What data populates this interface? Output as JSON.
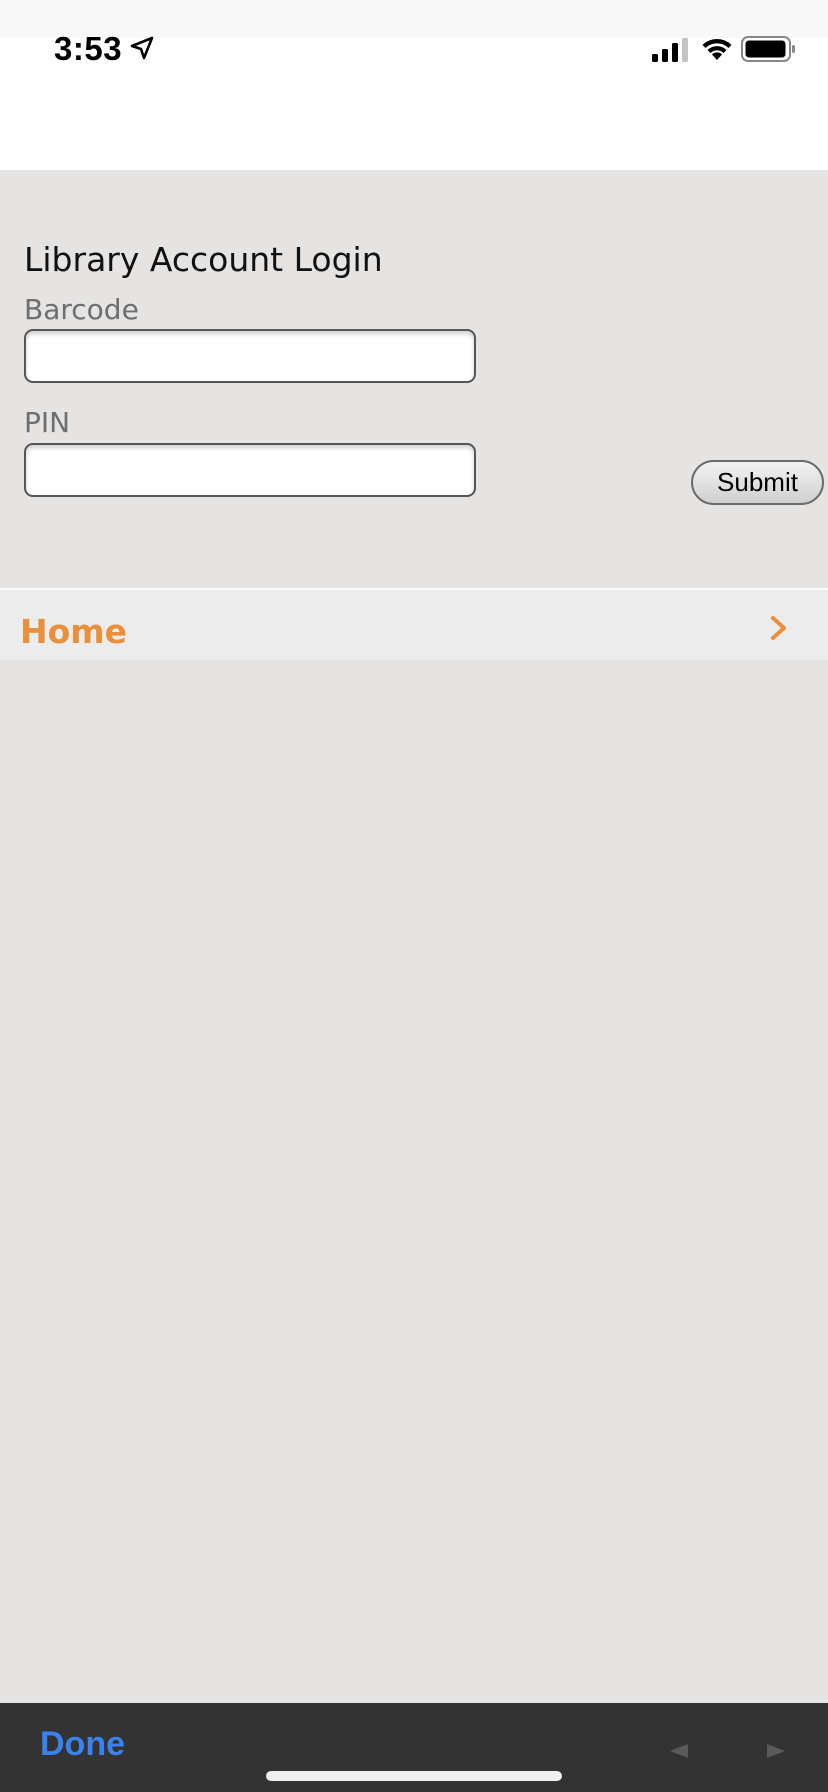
{
  "status_bar": {
    "time": "3:53",
    "icons": [
      "location-arrow-icon",
      "cellular-signal-icon",
      "wifi-icon",
      "battery-icon"
    ]
  },
  "login": {
    "title": "Library Account Login",
    "barcode_label": "Barcode",
    "barcode_value": "",
    "pin_label": "PIN",
    "pin_value": "",
    "submit_label": "Submit"
  },
  "nav": {
    "home_label": "Home"
  },
  "bottom_bar": {
    "done_label": "Done",
    "prev_icon": "triangle-left-icon",
    "next_icon": "triangle-right-icon"
  },
  "colors": {
    "accent_orange": "#e8903c",
    "done_blue": "#3a82f0",
    "background": "#e5e4e3",
    "toolbar": "#333333"
  }
}
